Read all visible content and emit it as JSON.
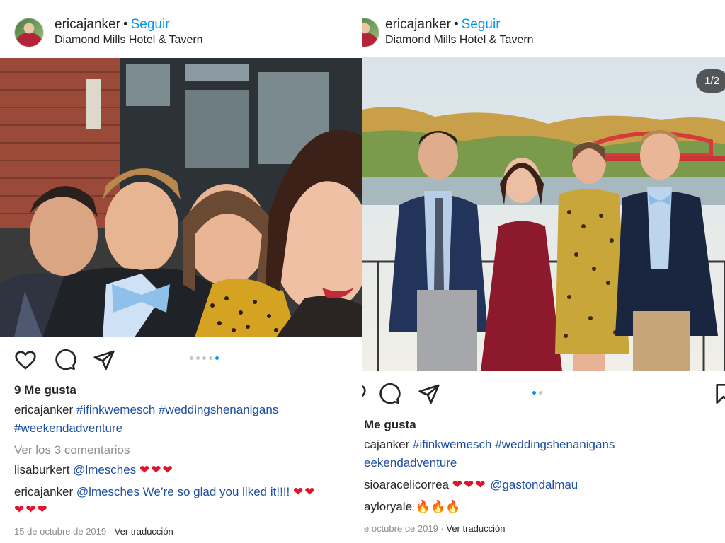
{
  "left": {
    "username": "ericajanker",
    "follow": "Seguir",
    "location": "Diamond Mills Hotel & Tavern",
    "likes": "9 Me gusta",
    "caption_user": "ericajanker",
    "caption_tags_line1": "#ifinkwemesch #weddingshenanigans",
    "caption_tags_line2": "#weekendadventure",
    "view_comments": "Ver los 3 comentarios",
    "comments": [
      {
        "user": "lisaburkert",
        "text": "@lmesches",
        "emoji": "❤❤❤"
      },
      {
        "user": "ericajanker",
        "text": "@lmesches We’re so glad you liked it!!!!",
        "emoji": "❤❤",
        "emoji2": "❤❤❤"
      }
    ],
    "date": "15 de octubre de 2019",
    "translate": "Ver traducción"
  },
  "right": {
    "username": "ericajanker",
    "follow": "Seguir",
    "location": "Diamond Mills Hotel & Tavern",
    "counter": "1/2",
    "likes": "Me gusta",
    "caption_user": "cajanker",
    "caption_tags_line1": "#ifinkwemesch #weddingshenanigans",
    "caption_tags_line2": "eekendadventure",
    "comments": [
      {
        "user": "sioaracelicorrea",
        "emoji": "❤❤❤",
        "text": "@gastondalmau"
      },
      {
        "user": "ayloryale",
        "emoji": "🔥🔥🔥"
      }
    ],
    "date": "e octubre de 2019",
    "translate": "Ver traducción"
  },
  "colors": {
    "link": "#0095f6",
    "hashtag": "#1f4fa3",
    "heart": "#e0152b",
    "muted": "#8e8e8e"
  },
  "icons": [
    "heart-icon",
    "comment-icon",
    "share-icon",
    "bookmark-icon",
    "more-icon"
  ]
}
